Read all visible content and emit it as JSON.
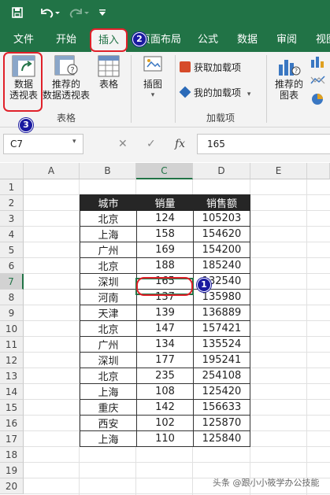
{
  "quick_access": {
    "save_icon": "save-icon",
    "undo_icon": "undo-icon",
    "redo_icon": "redo-icon",
    "customize_icon": "customize-qat-icon"
  },
  "tabs": [
    {
      "label": "文件"
    },
    {
      "label": "开始"
    },
    {
      "label": "插入",
      "active": true
    },
    {
      "label": "页面布局"
    },
    {
      "label": "公式"
    },
    {
      "label": "数据"
    },
    {
      "label": "审阅"
    },
    {
      "label": "视图"
    }
  ],
  "ribbon": {
    "pivot_table": "数据\n透视表",
    "recommended_pivot": "推荐的\n数据透视表",
    "table": "表格",
    "tables_group": "表格",
    "illustrations": "插图",
    "get_addins": "获取加载项",
    "my_addins": "我的加载项",
    "addins_group": "加载项",
    "recommended_charts": "推荐的\n图表"
  },
  "formula_bar": {
    "name_box": "C7",
    "fx": "fx",
    "value": "165"
  },
  "columns": [
    "A",
    "B",
    "C",
    "D",
    "E"
  ],
  "selected_column": "C",
  "rows": [
    "1",
    "2",
    "3",
    "4",
    "5",
    "6",
    "7",
    "8",
    "9",
    "10",
    "11",
    "12",
    "13",
    "14",
    "15",
    "16",
    "17",
    "18",
    "19",
    "20"
  ],
  "selected_row": "7",
  "table": {
    "headers": [
      "城市",
      "销量",
      "销售额"
    ],
    "rows": [
      [
        "北京",
        "124",
        "105203"
      ],
      [
        "上海",
        "158",
        "154620"
      ],
      [
        "广州",
        "169",
        "154200"
      ],
      [
        "北京",
        "188",
        "185240"
      ],
      [
        "深圳",
        "165",
        "132540"
      ],
      [
        "河南",
        "137",
        "135980"
      ],
      [
        "天津",
        "139",
        "136889"
      ],
      [
        "北京",
        "147",
        "157421"
      ],
      [
        "广州",
        "134",
        "135524"
      ],
      [
        "深圳",
        "177",
        "195241"
      ],
      [
        "北京",
        "235",
        "254108"
      ],
      [
        "上海",
        "108",
        "125420"
      ],
      [
        "重庆",
        "142",
        "156633"
      ],
      [
        "西安",
        "102",
        "125870"
      ],
      [
        "上海",
        "110",
        "125840"
      ]
    ]
  },
  "badges": [
    "1",
    "2",
    "3"
  ],
  "watermark": "头条 @跟小小筱学办公技能",
  "colors": {
    "excel_green": "#217346",
    "badge_blue": "#1a1aa0",
    "highlight_red": "#e0212a"
  }
}
